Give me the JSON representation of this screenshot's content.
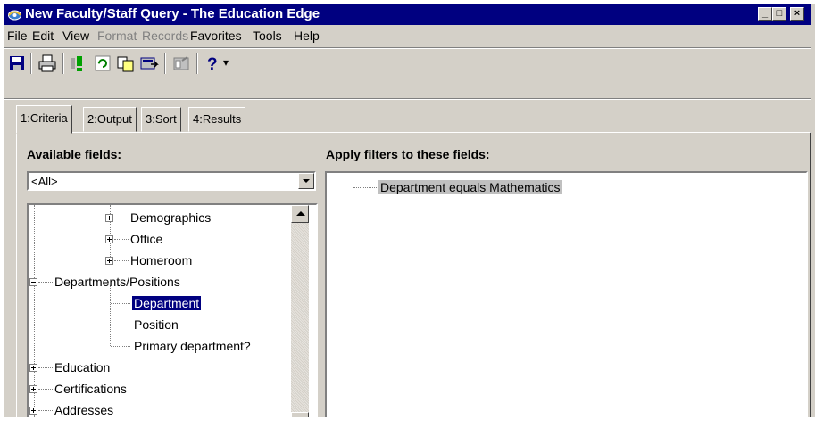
{
  "window": {
    "title": "New Faculty/Staff Query - The Education Edge",
    "controls": [
      "_",
      "□",
      "×"
    ]
  },
  "menubar": {
    "items": [
      {
        "label": "File",
        "enabled": true
      },
      {
        "label": "Edit",
        "enabled": true
      },
      {
        "label": "View",
        "enabled": true
      },
      {
        "label": "Format",
        "enabled": false
      },
      {
        "label": "Records",
        "enabled": false
      },
      {
        "label": "Favorites",
        "enabled": true
      },
      {
        "label": "Tools",
        "enabled": true
      },
      {
        "label": "Help",
        "enabled": true
      }
    ]
  },
  "toolbar": {
    "icons": [
      "save-icon",
      "print-icon",
      "run-query-icon",
      "refresh-icon",
      "copy-icon",
      "export-icon",
      "properties-icon",
      "help-icon"
    ],
    "help_dropdown": "▾"
  },
  "tabs": [
    {
      "label": "1:Criteria",
      "active": true
    },
    {
      "label": "2:Output",
      "active": false
    },
    {
      "label": "3:Sort",
      "active": false
    },
    {
      "label": "4:Results",
      "active": false
    }
  ],
  "available_fields": {
    "label": "Available fields:",
    "filter_value": "<All>",
    "tree": [
      {
        "label": "Demographics",
        "expandable": true,
        "selected": false
      },
      {
        "label": "Office",
        "expandable": true,
        "selected": false
      },
      {
        "label": "Homeroom",
        "expandable": true,
        "selected": false
      },
      {
        "label": "Departments/Positions",
        "expandable": true,
        "expanded": true,
        "selected": false
      },
      {
        "label": "Department",
        "expandable": false,
        "selected": true
      },
      {
        "label": "Position",
        "expandable": false,
        "selected": false
      },
      {
        "label": "Primary department?",
        "expandable": false,
        "selected": false
      },
      {
        "label": "Education",
        "expandable": true,
        "selected": false
      },
      {
        "label": "Certifications",
        "expandable": true,
        "selected": false
      },
      {
        "label": "Addresses",
        "expandable": true,
        "selected": false
      }
    ]
  },
  "filters_pane": {
    "label": "Apply filters to these fields:",
    "items": [
      "Department equals Mathematics"
    ]
  },
  "colors": {
    "title_bar": "#000080",
    "face": "#d4d0c8",
    "selection": "#000080"
  }
}
